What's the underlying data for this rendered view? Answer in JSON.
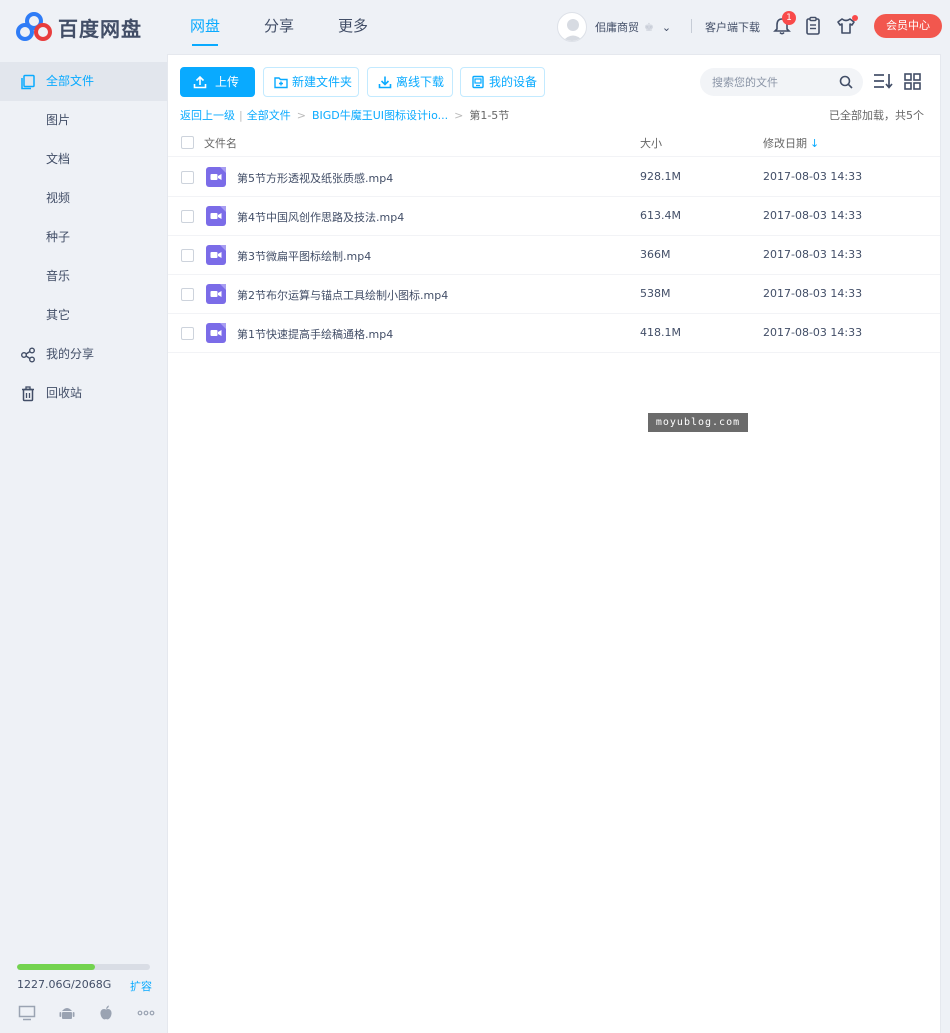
{
  "header": {
    "logo_text": "百度网盘",
    "nav": [
      "网盘",
      "分享",
      "更多"
    ],
    "username": "佀庸商贸",
    "client_download": "客户端下载",
    "notification_count": "1",
    "vip_button": "会员中心",
    "colors": {
      "accent": "#09aaff",
      "vip": "#f2574e",
      "badge": "#f94a4a"
    }
  },
  "sidebar": {
    "items": [
      {
        "label": "全部文件",
        "icon": "files-icon"
      },
      {
        "label": "图片"
      },
      {
        "label": "文档"
      },
      {
        "label": "视频"
      },
      {
        "label": "种子"
      },
      {
        "label": "音乐"
      },
      {
        "label": "其它"
      },
      {
        "label": "我的分享",
        "icon": "share-icon"
      },
      {
        "label": "回收站",
        "icon": "trash-icon"
      }
    ],
    "quota_text": "1227.06G/2068G",
    "quota_used_fraction": 0.59,
    "expand_label": "扩容",
    "platforms": [
      "pc-icon",
      "android-icon",
      "apple-icon",
      "more-icon"
    ]
  },
  "toolbar": {
    "upload": "上传",
    "new_folder": "新建文件夹",
    "offline_download": "离线下载",
    "my_devices": "我的设备",
    "search_placeholder": "搜索您的文件"
  },
  "breadcrumb": {
    "back": "返回上一级",
    "root": "全部文件",
    "folder": "BIGD牛魔王UI图标设计io...",
    "current": "第1-5节",
    "loaded_status": "已全部加载，共5个"
  },
  "table": {
    "columns": [
      "文件名",
      "大小",
      "修改日期"
    ],
    "rows": [
      {
        "name": "第5节方形透视及纸张质感.mp4",
        "size": "928.1M",
        "date": "2017-08-03 14:33"
      },
      {
        "name": "第4节中国风创作思路及技法.mp4",
        "size": "613.4M",
        "date": "2017-08-03 14:33"
      },
      {
        "name": "第3节微扁平图标绘制.mp4",
        "size": "366M",
        "date": "2017-08-03 14:33"
      },
      {
        "name": "第2节布尔运算与锚点工具绘制小图标.mp4",
        "size": "538M",
        "date": "2017-08-03 14:33"
      },
      {
        "name": "第1节快速提高手绘稿通格.mp4",
        "size": "418.1M",
        "date": "2017-08-03 14:33"
      }
    ]
  },
  "watermark": "moyublog.com"
}
